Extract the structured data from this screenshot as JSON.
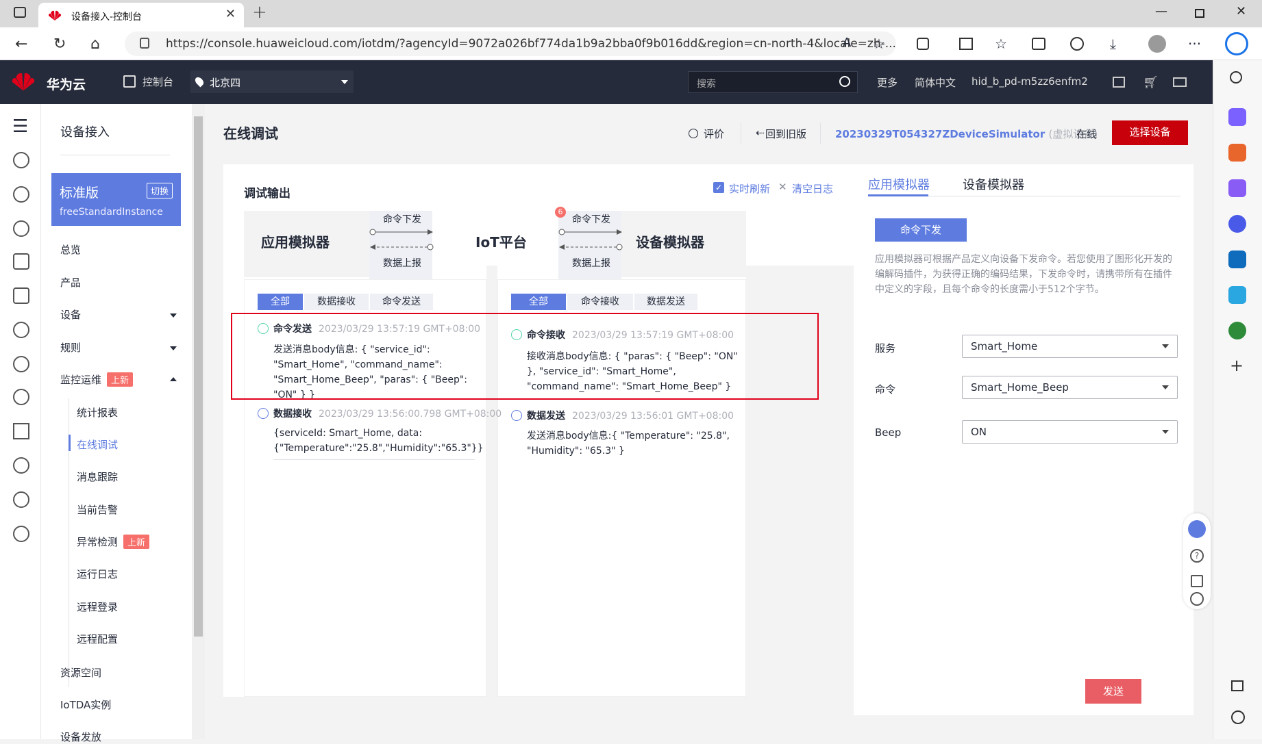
{
  "browser": {
    "tab_title": "设备接入-控制台",
    "url": "https://console.huaweicloud.com/iotdm/?agencyId=9072a026bf774da1b9a2bba0f9b016dd&region=cn-north-4&locale=zh-..."
  },
  "header": {
    "brand": "华为云",
    "console": "控制台",
    "region": "北京四",
    "search_placeholder": "搜索",
    "more": "更多",
    "language": "简体中文",
    "user": "hid_b_pd-m5zz6enfm2"
  },
  "menu": {
    "title": "设备接入",
    "edition": "标准版",
    "switch": "切换",
    "instance": "freeStandardInstance",
    "items": [
      "总览",
      "产品",
      "设备",
      "规则",
      "监控运维"
    ],
    "new_badge": "上新",
    "sub_items": [
      "统计报表",
      "在线调试",
      "消息跟踪",
      "当前告警",
      "异常检测",
      "运行日志",
      "远程登录",
      "远程配置"
    ],
    "bottom_items": [
      "资源空间",
      "IoTDA实例",
      "设备发放"
    ]
  },
  "page": {
    "title": "在线调试",
    "rate": "评价",
    "back_old": "回到旧版",
    "device_name": "20230329T054327ZDeviceSimulator",
    "device_tag": "(虚拟设备)",
    "status": "在线",
    "select_device": "选择设备"
  },
  "output": {
    "title": "调试输出",
    "realtime": "实时刷新",
    "clear": "清空日志",
    "app_sim": "应用模拟器",
    "iot": "IoT平台",
    "dev_sim": "设备模拟器",
    "cmd_down": "命令下发",
    "data_up": "数据上报",
    "badge": "6",
    "left_tabs": [
      "全部",
      "数据接收",
      "命令发送"
    ],
    "right_tabs": [
      "全部",
      "命令接收",
      "数据发送"
    ],
    "left_logs": [
      {
        "head": "命令发送",
        "time": "2023/03/29 13:57:19 GMT+08:00",
        "body": "发送消息body信息: { \"service_id\": \"Smart_Home\", \"command_name\": \"Smart_Home_Beep\", \"paras\": { \"Beep\": \"ON\" } }"
      },
      {
        "head": "数据接收",
        "time": "2023/03/29 13:56:00.798 GMT+08:00",
        "body": "{serviceId: Smart_Home, data: {\"Temperature\":\"25.8\",\"Humidity\":\"65.3\"}}"
      }
    ],
    "right_logs": [
      {
        "head": "命令接收",
        "time": "2023/03/29 13:57:19 GMT+08:00",
        "body": "接收消息body信息: { \"paras\": { \"Beep\": \"ON\" }, \"service_id\": \"Smart_Home\", \"command_name\": \"Smart_Home_Beep\" }"
      },
      {
        "head": "数据发送",
        "time": "2023/03/29 13:56:01 GMT+08:00",
        "body": "发送消息body信息:{ \"Temperature\": \"25.8\", \"Humidity\": \"65.3\" }"
      }
    ]
  },
  "panel": {
    "tab_app": "应用模拟器",
    "tab_dev": "设备模拟器",
    "cmd_button": "命令下发",
    "desc": "应用模拟器可根据产品定义向设备下发命令。若您使用了图形化开发的编解码插件，为获得正确的编码结果，下发命令时，请携带所有在插件中定义的字段，且每个命令的长度需小于512个字节。",
    "service_label": "服务",
    "service_value": "Smart_Home",
    "command_label": "命令",
    "command_value": "Smart_Home_Beep",
    "beep_label": "Beep",
    "beep_value": "ON",
    "send": "发送"
  },
  "colors": {
    "accent": "#5e7ce0",
    "danger": "#c7000b",
    "header_bg": "#252b3a",
    "highlight_box": "#e0001a"
  }
}
